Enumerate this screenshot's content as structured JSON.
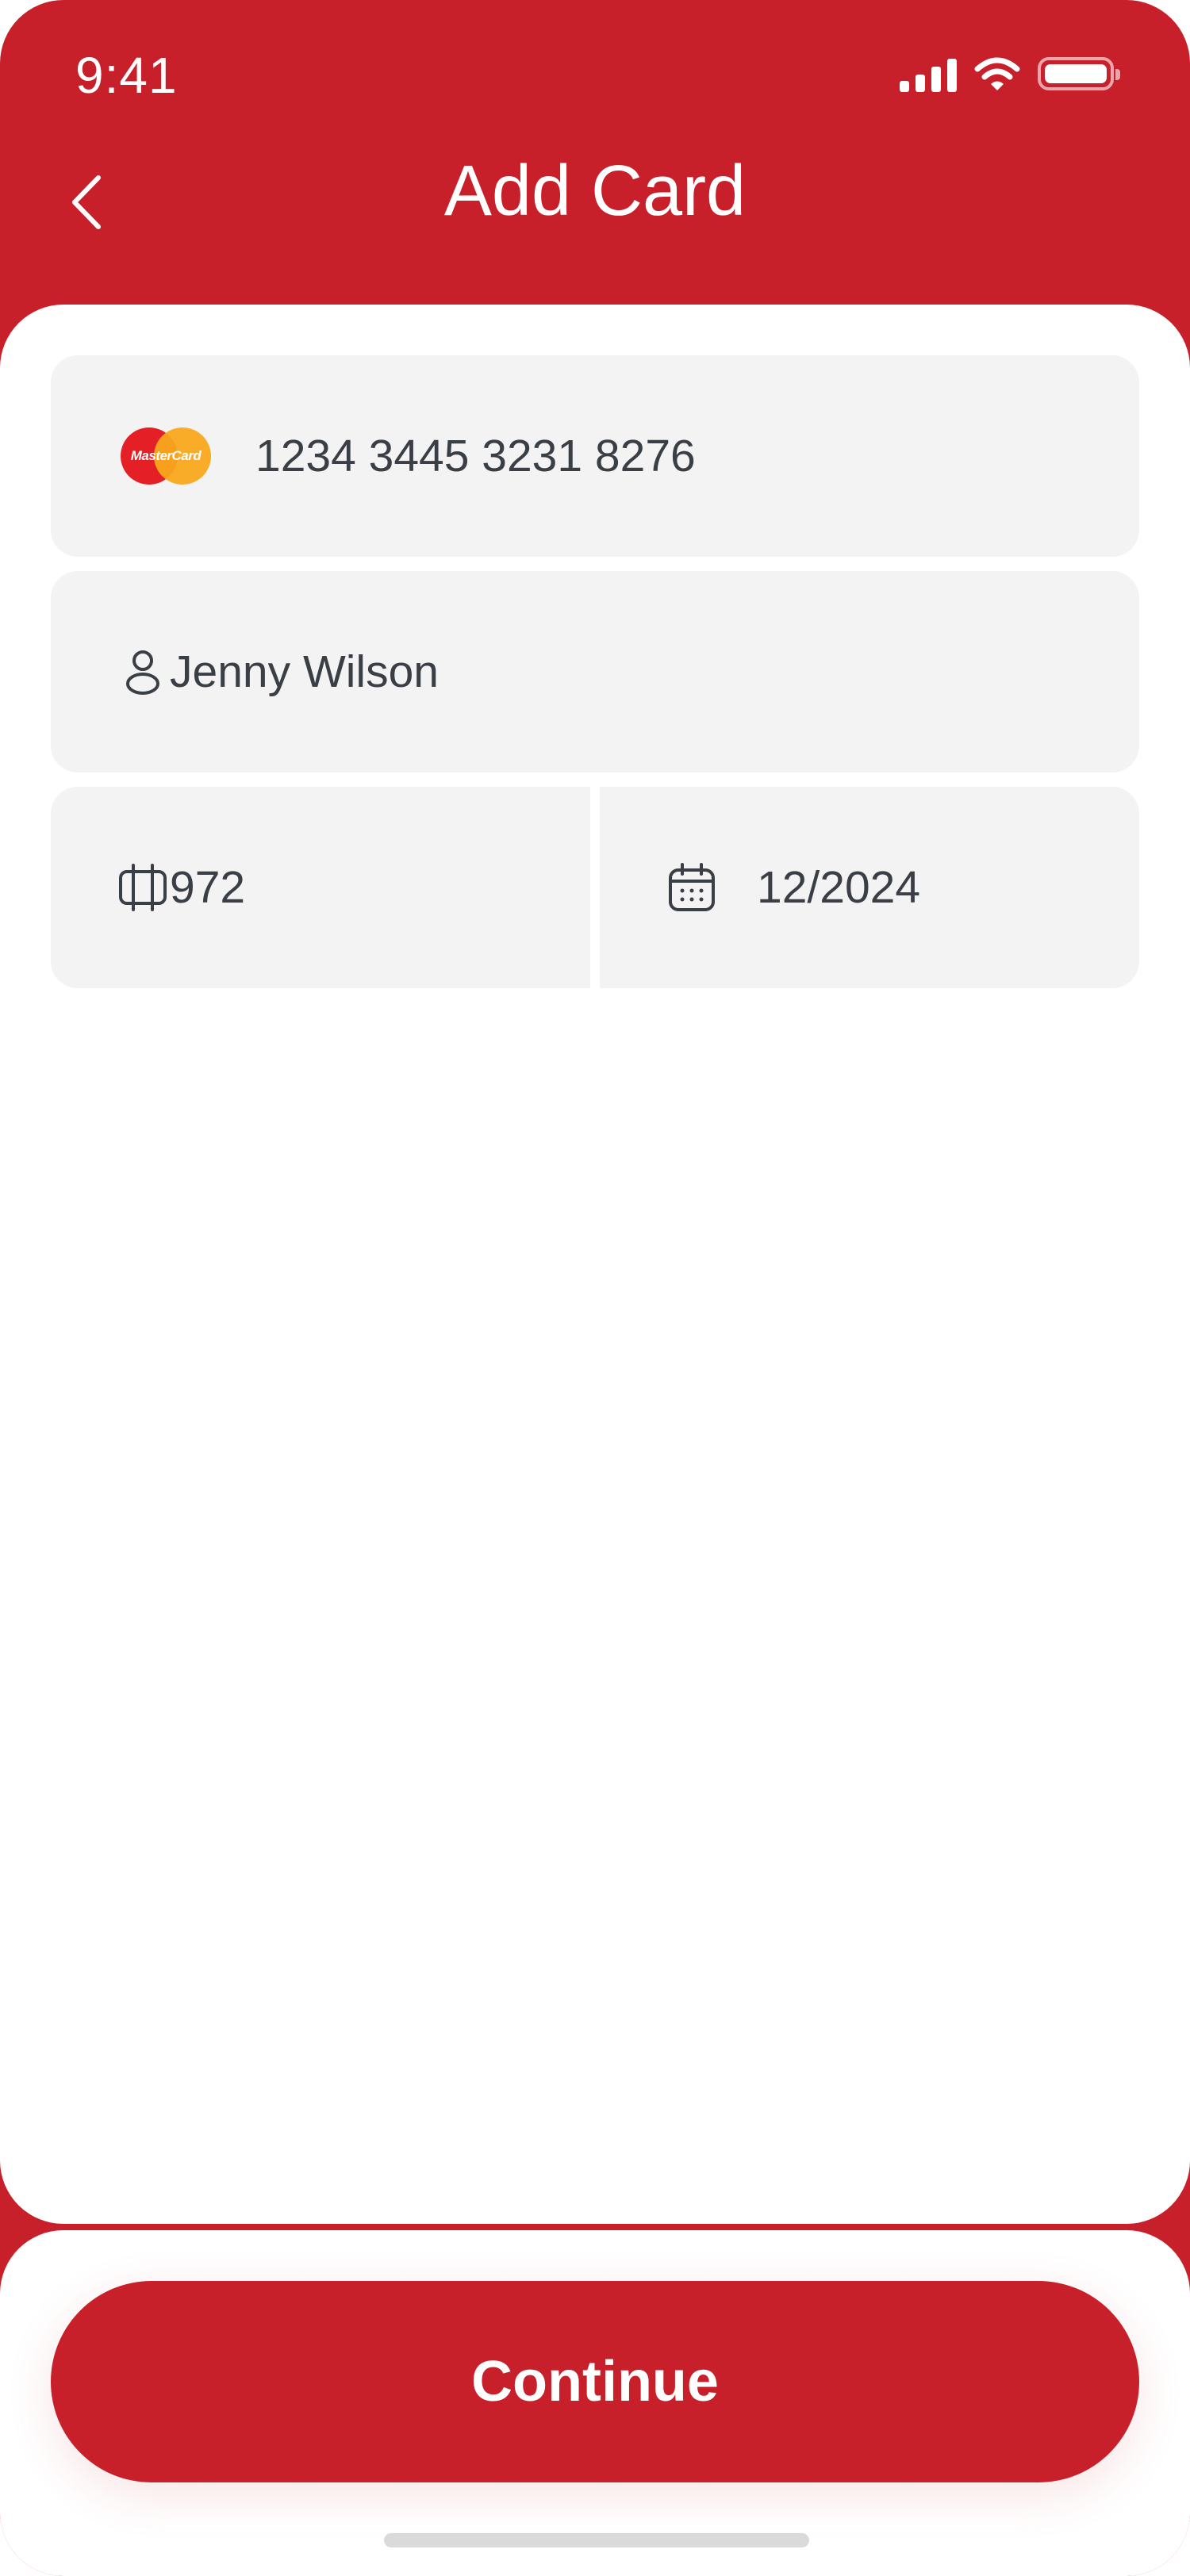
{
  "status_bar": {
    "time": "9:41"
  },
  "header": {
    "title": "Add Card",
    "back_icon": "chevron-left-icon"
  },
  "form": {
    "card_number": {
      "value": "1234 3445 3231 8276",
      "brand": "MasterCard",
      "brand_colors": [
        "#E41F26",
        "#F9A81C"
      ]
    },
    "cardholder_name": {
      "value": "Jenny Wilson",
      "icon": "user-icon"
    },
    "cvv": {
      "value": "972",
      "icon": "card-cvv-icon"
    },
    "expiry": {
      "value": "12/2024",
      "icon": "calendar-icon"
    }
  },
  "footer": {
    "continue_label": "Continue"
  },
  "colors": {
    "accent": "#C8202A",
    "field_bg": "#F3F3F3",
    "text": "#3A3E45"
  }
}
